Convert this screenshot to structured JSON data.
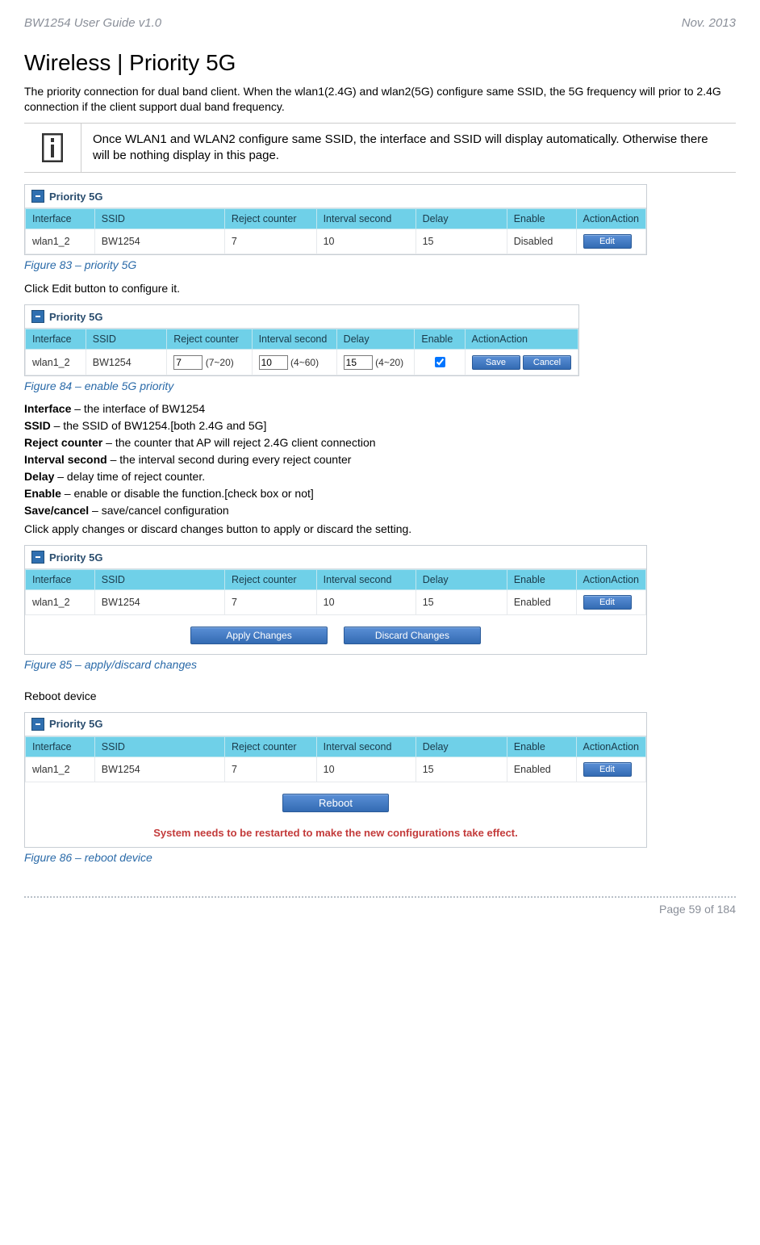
{
  "header": {
    "left": "BW1254 User Guide v1.0",
    "right": "Nov.  2013"
  },
  "section_title": "Wireless | Priority 5G",
  "intro": "The priority connection for dual band client. When the wlan1(2.4G) and wlan2(5G) configure same SSID, the 5G frequency will prior to 2.4G connection if the client support dual band frequency.",
  "info_note": "Once WLAN1 and WLAN2 configure same SSID, the interface and SSID will display automatically. Otherwise there will be nothing display in this page.",
  "panel_title": "Priority 5G",
  "columns": {
    "interface": "Interface",
    "ssid": "SSID",
    "reject": "Reject counter",
    "interval": "Interval second",
    "delay": "Delay",
    "enable": "Enable",
    "action": "ActionAction"
  },
  "row_common": {
    "interface": "wlan1_2",
    "ssid": "BW1254",
    "reject": "7",
    "interval": "10",
    "delay": "15"
  },
  "fig83": {
    "enable": "Disabled",
    "caption": "Figure 83 – priority 5G"
  },
  "edit_instruction": "Click Edit button to configure it.",
  "fig84": {
    "reject_range": "(7~20)",
    "interval_range": "(4~60)",
    "delay_range": "(4~20)",
    "caption": "Figure 84 – enable 5G priority"
  },
  "buttons": {
    "edit": "Edit",
    "save": "Save",
    "cancel": "Cancel",
    "apply": "Apply Changes",
    "discard": "Discard Changes",
    "reboot": "Reboot"
  },
  "defs": {
    "interface": {
      "t": "Interface",
      "d": " – the interface of BW1254"
    },
    "ssid": {
      "t": "SSID",
      "d": " – the SSID of BW1254.[both 2.4G and 5G]"
    },
    "reject": {
      "t": "Reject counter",
      "d": " – the counter that AP will reject 2.4G client connection"
    },
    "interval": {
      "t": "Interval second",
      "d": " – the interval second during every reject counter"
    },
    "delay": {
      "t": "Delay",
      "d": " – delay time of reject counter."
    },
    "enable": {
      "t": "Enable",
      "d": " – enable or disable the function.[check box or not]"
    },
    "savecancel": {
      "t": "Save/cancel",
      "d": " – save/cancel configuration"
    }
  },
  "apply_instruction": "Click apply changes or discard changes button to apply or discard the setting.",
  "fig85": {
    "enable": "Enabled",
    "caption": "Figure 85 – apply/discard changes"
  },
  "reboot_heading": "Reboot device",
  "fig86": {
    "enable": "Enabled",
    "sysmsg": "System needs to be restarted to make the new configurations take effect.",
    "caption": "Figure 86 – reboot device"
  },
  "footer": "Page 59 of 184"
}
